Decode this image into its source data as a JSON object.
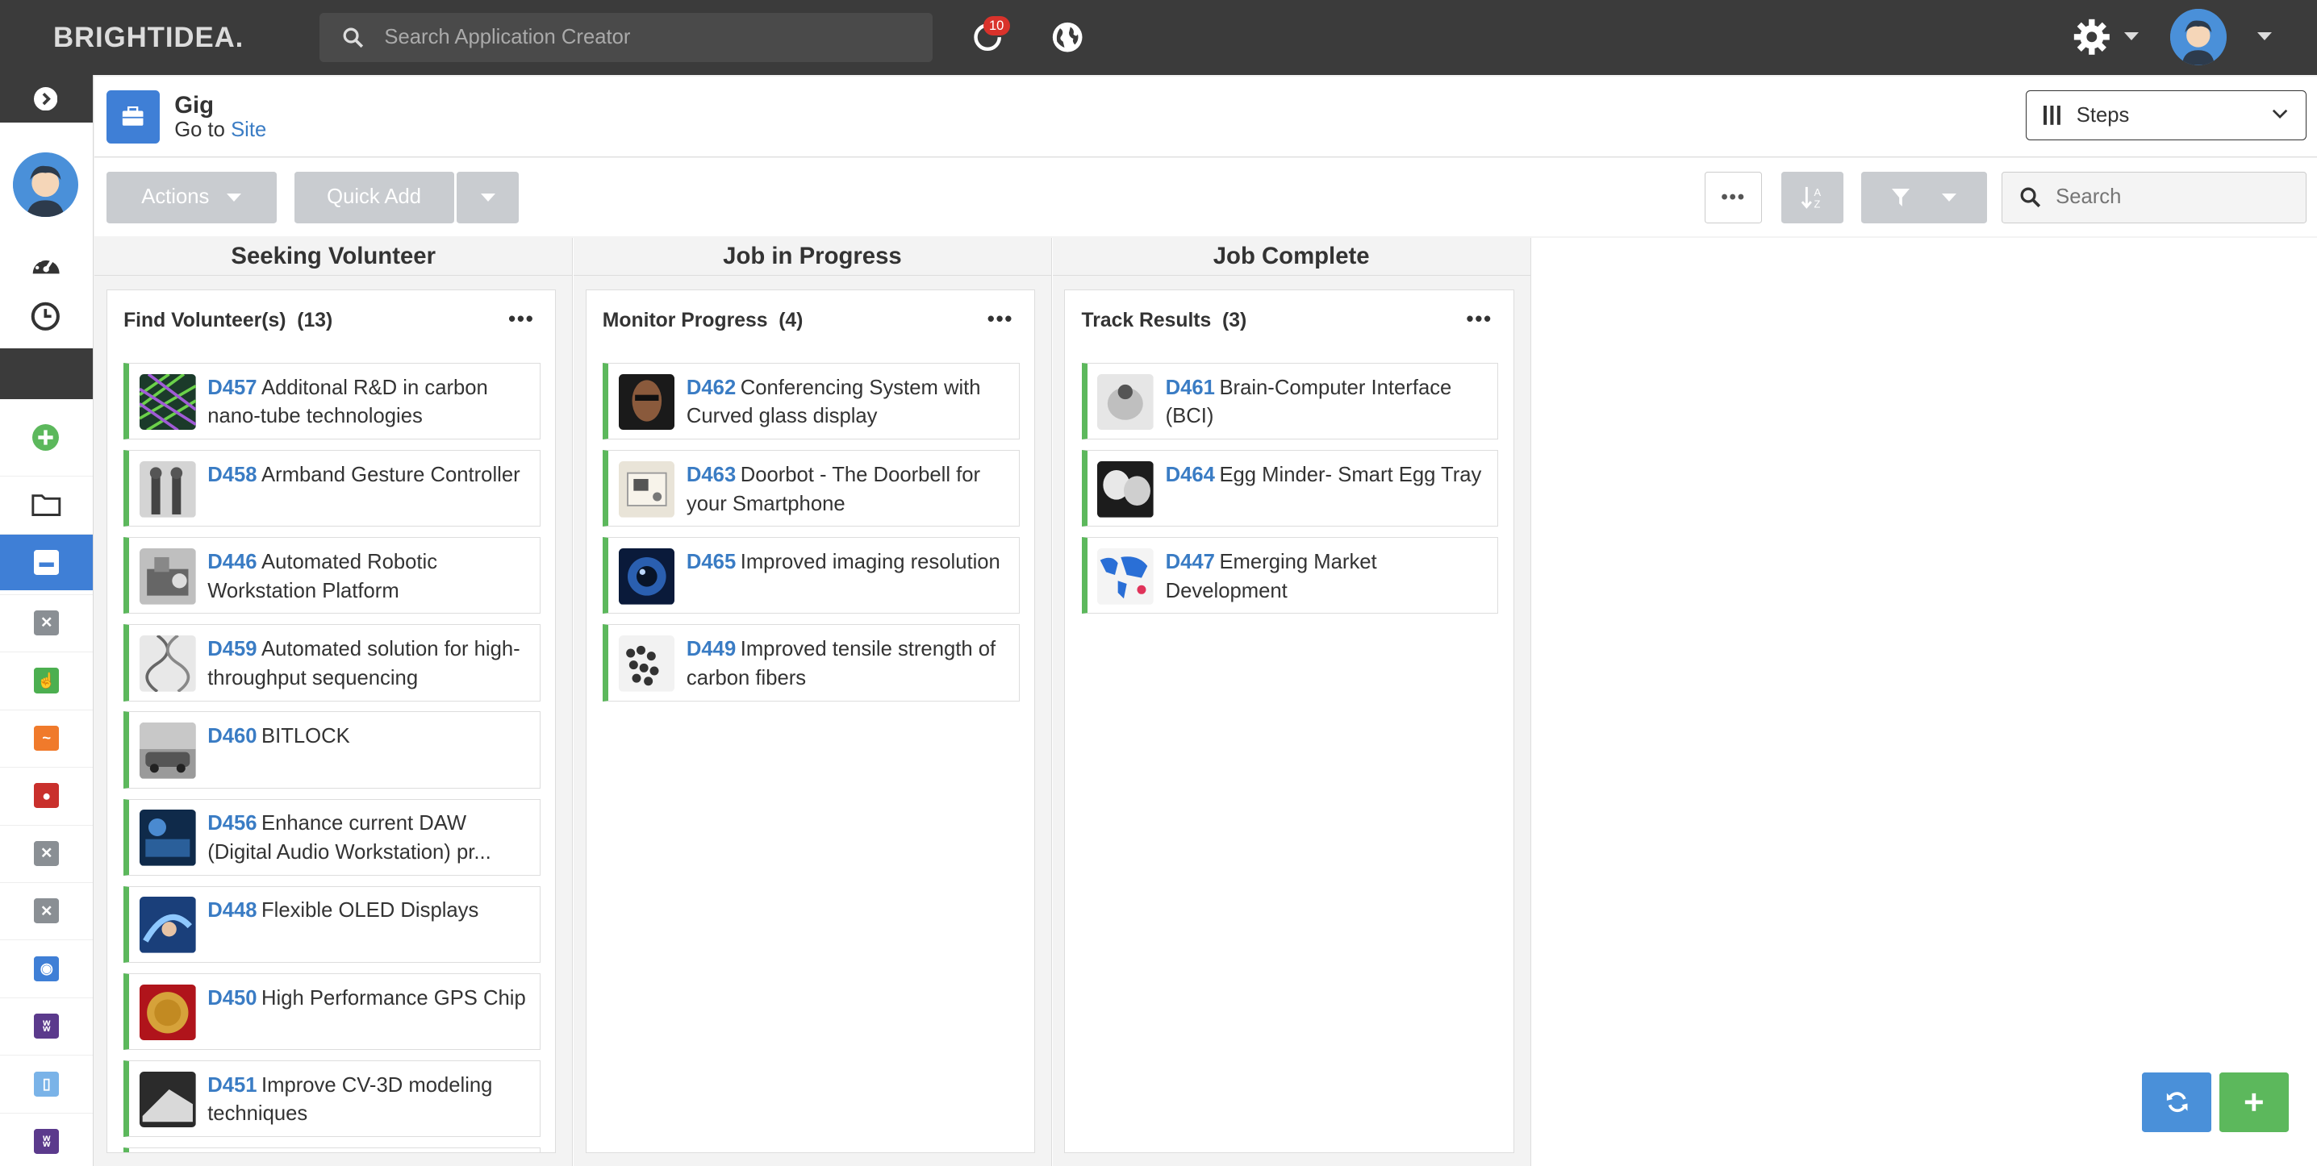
{
  "topbar": {
    "logo": "BRIGHTIDEA.",
    "search_placeholder": "Search Application Creator",
    "notification_count": "10"
  },
  "header": {
    "app_title": "Gig",
    "goto_prefix": "Go to",
    "goto_link": "Site",
    "view_select": "Steps"
  },
  "toolbar": {
    "actions_label": "Actions",
    "quick_add_label": "Quick Add",
    "search_placeholder": "Search"
  },
  "columns": [
    {
      "title": "Seeking Volunteer",
      "lane_title": "Find Volunteer(s)",
      "lane_count": "(13)",
      "cards": [
        {
          "id": "D457",
          "title": "Additonal R&D in carbon nano-tube technologies"
        },
        {
          "id": "D458",
          "title": "Armband Gesture Controller"
        },
        {
          "id": "D446",
          "title": "Automated Robotic Workstation Platform"
        },
        {
          "id": "D459",
          "title": "Automated solution for high-throughput sequencing"
        },
        {
          "id": "D460",
          "title": "BITLOCK"
        },
        {
          "id": "D456",
          "title": "Enhance current DAW (Digital Audio Workstation) pr..."
        },
        {
          "id": "D448",
          "title": "Flexible OLED Displays"
        },
        {
          "id": "D450",
          "title": "High Performance GPS Chip"
        },
        {
          "id": "D451",
          "title": "Improve CV-3D modeling techniques"
        }
      ]
    },
    {
      "title": "Job in Progress",
      "lane_title": "Monitor Progress",
      "lane_count": "(4)",
      "cards": [
        {
          "id": "D462",
          "title": "Conferencing System with Curved glass display"
        },
        {
          "id": "D463",
          "title": "Doorbot - The Doorbell for your Smartphone"
        },
        {
          "id": "D465",
          "title": "Improved imaging resolution"
        },
        {
          "id": "D449",
          "title": "Improved tensile strength of carbon fibers"
        }
      ]
    },
    {
      "title": "Job Complete",
      "lane_title": "Track Results",
      "lane_count": "(3)",
      "cards": [
        {
          "id": "D461",
          "title": "Brain-Computer Interface (BCI)"
        },
        {
          "id": "D464",
          "title": "Egg Minder- Smart Egg Tray"
        },
        {
          "id": "D447",
          "title": "Emerging Market Development"
        }
      ]
    }
  ],
  "colors": {
    "topbar": "#3b3b3b",
    "accent": "#3f7fd6",
    "link": "#3a7cc4",
    "card_stripe": "#5cb85c",
    "refresh_button": "#4a90d9",
    "add_button": "#5cb85c"
  },
  "icons": {
    "refresh": "refresh-icon",
    "add": "plus-icon",
    "notifications": "refresh-circle-icon",
    "globe": "globe-icon",
    "settings": "gear-icon"
  }
}
